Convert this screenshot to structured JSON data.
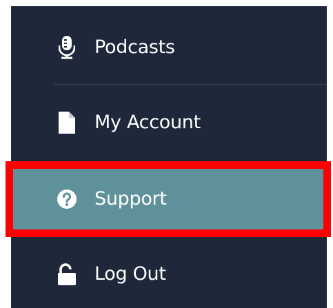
{
  "menu": {
    "items": [
      {
        "label": "Podcasts",
        "icon": "microphone-icon"
      },
      {
        "label": "My Account",
        "icon": "document-icon"
      },
      {
        "label": "Support",
        "icon": "question-circle-icon",
        "active": true
      },
      {
        "label": "Log Out",
        "icon": "unlock-icon"
      }
    ]
  },
  "colors": {
    "panel_bg": "#1e283a",
    "active_bg": "#5e9199",
    "highlight_border": "#ff0000",
    "text": "#ffffff"
  }
}
